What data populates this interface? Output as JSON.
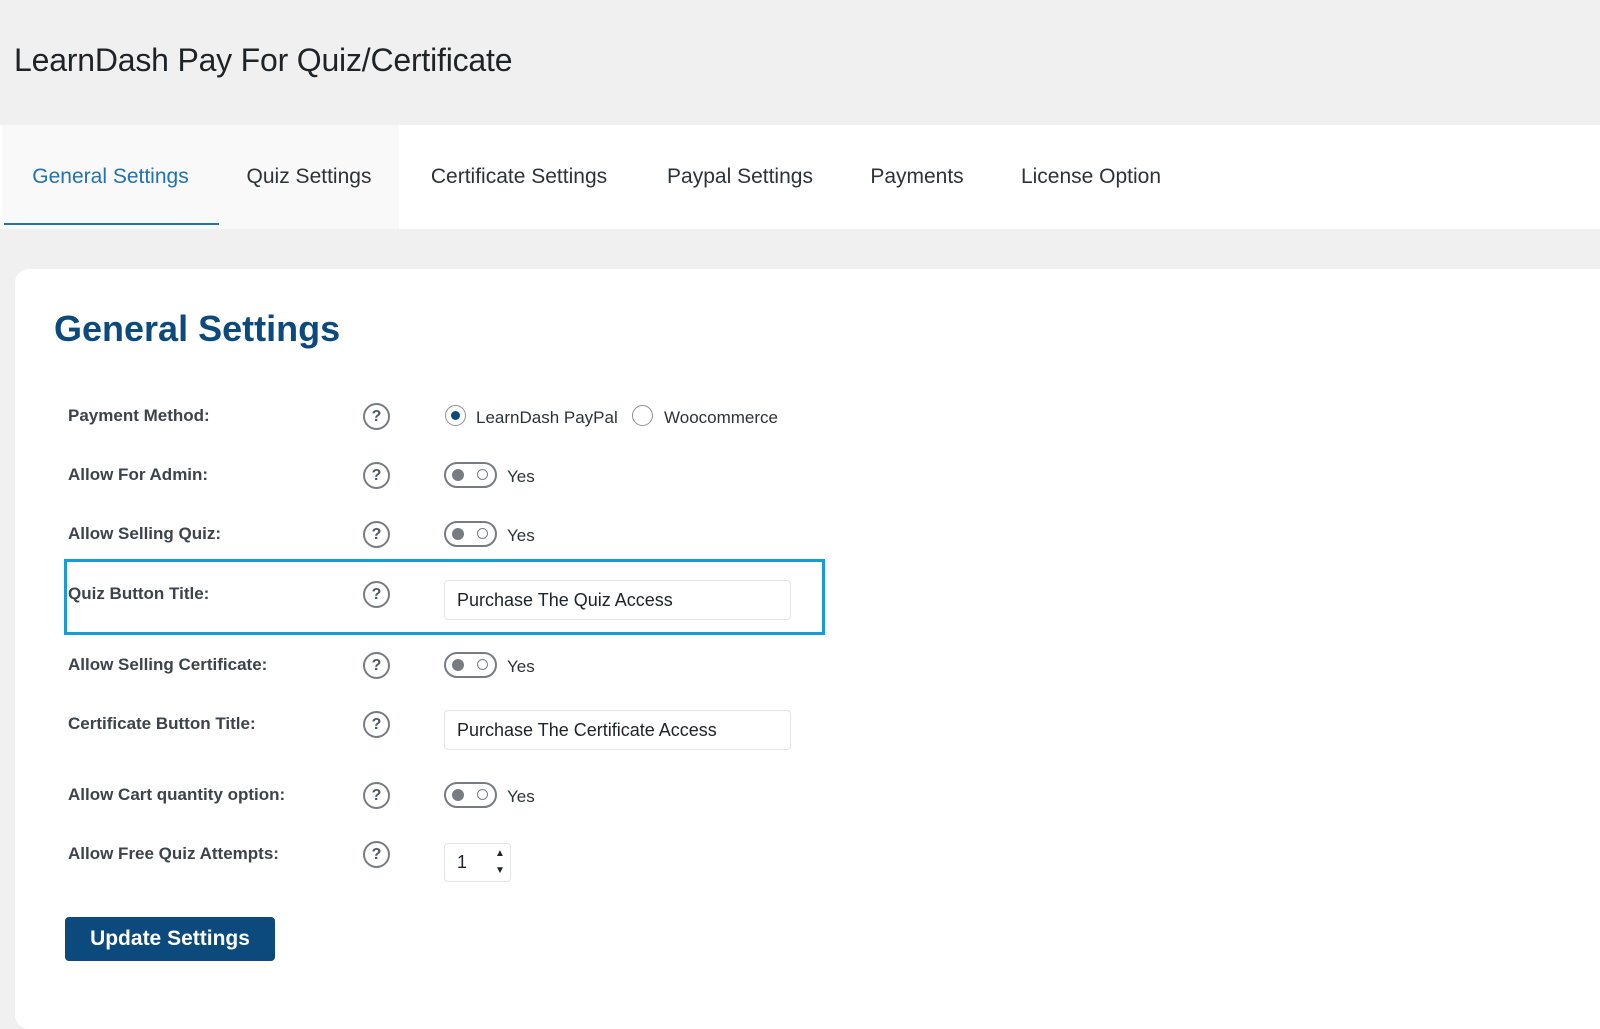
{
  "page": {
    "title": "LearnDash Pay For Quiz/Certificate"
  },
  "tabs": [
    {
      "label": "General Settings",
      "active": true
    },
    {
      "label": "Quiz Settings"
    },
    {
      "label": "Certificate Settings"
    },
    {
      "label": "Paypal Settings"
    },
    {
      "label": "Payments"
    },
    {
      "label": "License Option"
    }
  ],
  "section": {
    "title": "General Settings"
  },
  "rows": {
    "payment_method": {
      "label": "Payment Method:",
      "options": [
        "LearnDash PayPal",
        "Woocommerce"
      ],
      "selected": "LearnDash PayPal"
    },
    "allow_for_admin": {
      "label": "Allow For Admin:",
      "toggle_label": "Yes",
      "enabled": false
    },
    "allow_selling_quiz": {
      "label": "Allow Selling Quiz:",
      "toggle_label": "Yes",
      "enabled": false
    },
    "quiz_button_title": {
      "label": "Quiz Button Title:",
      "value": "Purchase The Quiz Access"
    },
    "allow_selling_certificate": {
      "label": "Allow Selling Certificate:",
      "toggle_label": "Yes",
      "enabled": false
    },
    "certificate_button_title": {
      "label": "Certificate Button Title:",
      "value": "Purchase The Certificate Access"
    },
    "allow_cart_quantity": {
      "label": "Allow Cart quantity option:",
      "toggle_label": "Yes",
      "enabled": false
    },
    "allow_free_quiz_attempts": {
      "label": "Allow Free Quiz Attempts:",
      "value": "1"
    }
  },
  "help_icon": "?",
  "update_button": {
    "label": "Update Settings"
  },
  "colors": {
    "accent": "#2271b1",
    "heading": "#0c4a7d",
    "button": "#0c4a7d",
    "highlight": "#1a9ad6"
  }
}
